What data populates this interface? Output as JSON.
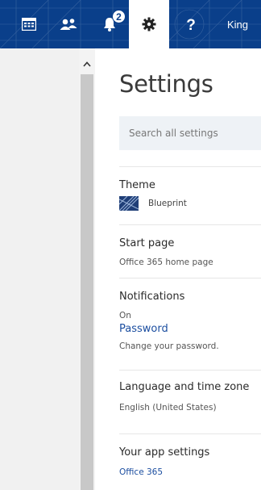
{
  "topbar": {
    "icons": {
      "calendar": "calendar-icon",
      "people": "people-icon",
      "notifications": "bell-icon",
      "settings": "gear-icon",
      "help": "help-icon"
    },
    "notification_count": "2",
    "user_name": "King",
    "accent": "#0a3f8a"
  },
  "settings": {
    "title": "Settings",
    "search_placeholder": "Search all settings",
    "items": [
      {
        "label": "Theme",
        "value": "Blueprint"
      },
      {
        "label": "Start page",
        "value": "Office 365 home page"
      },
      {
        "label": "Notifications",
        "value": "On"
      },
      {
        "label": "Password",
        "value": "Change your password."
      },
      {
        "label": "Language and time zone",
        "value": "English (United States)"
      },
      {
        "label": "Your app settings",
        "value": "Office 365"
      }
    ]
  }
}
